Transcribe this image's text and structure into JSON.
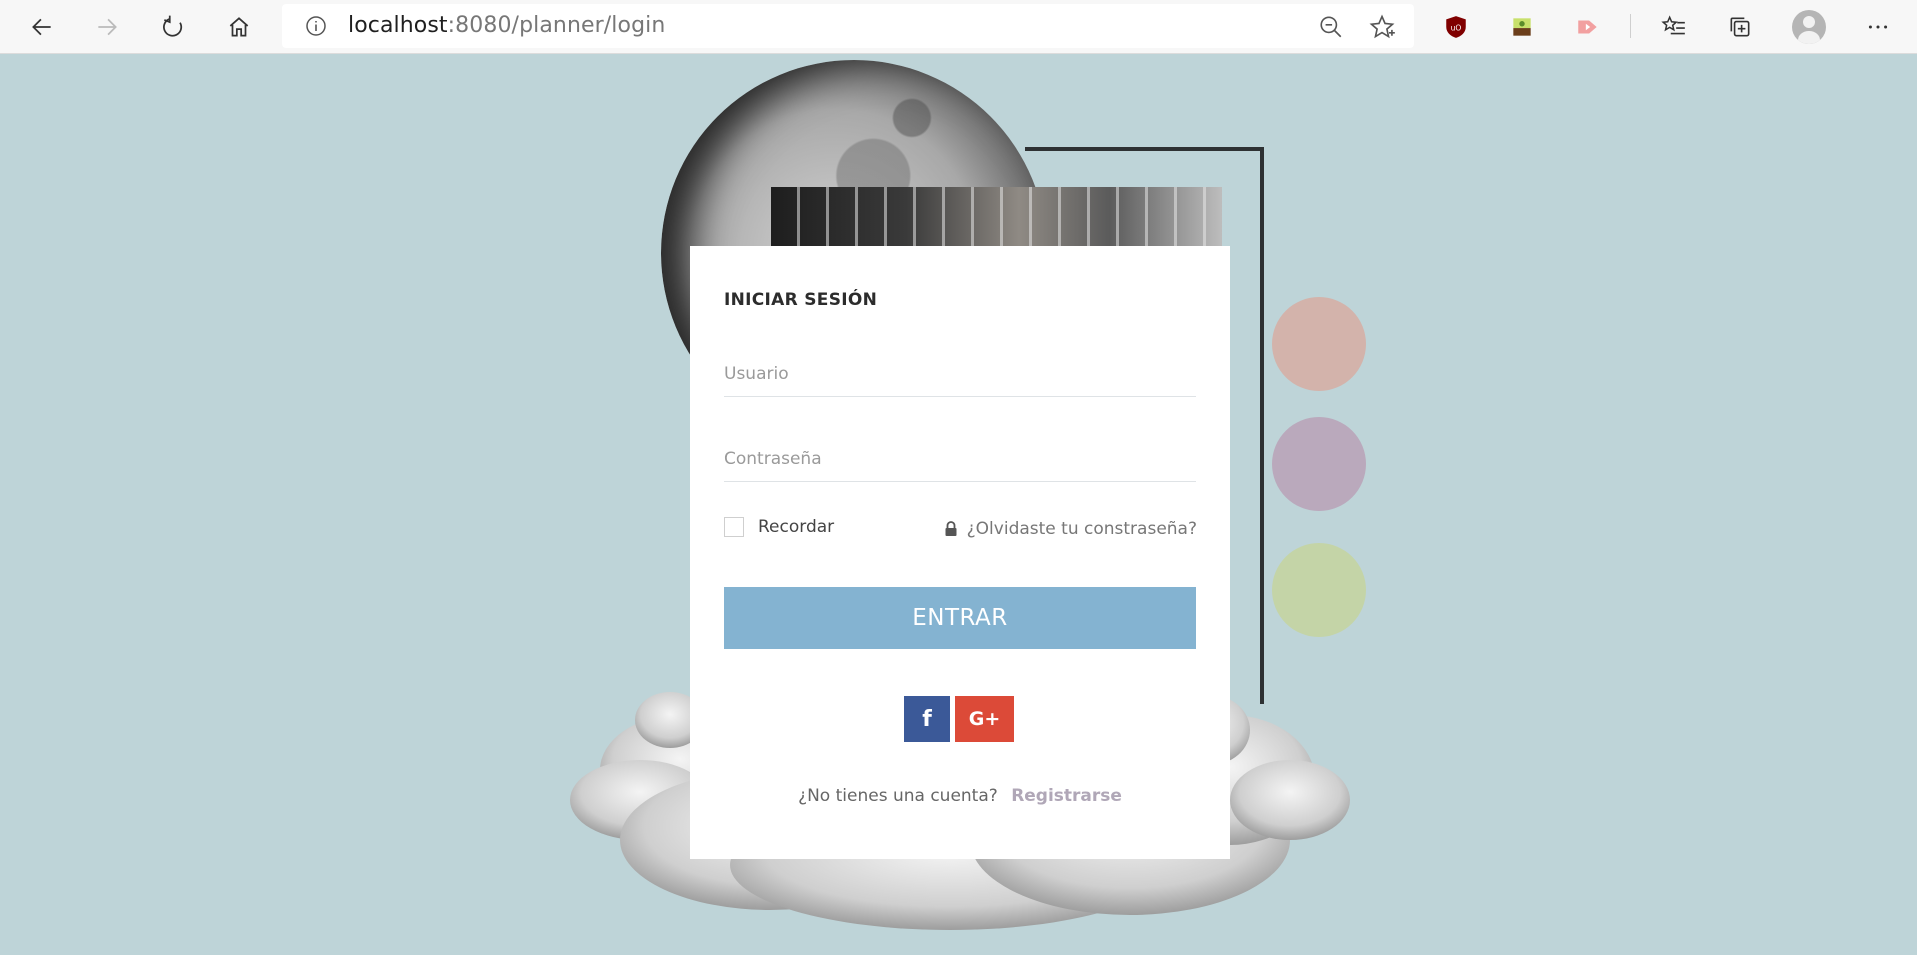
{
  "browser": {
    "url_host": "localhost",
    "url_rest": ":8080/planner/login",
    "icons": [
      "back-icon",
      "forward-icon",
      "refresh-icon",
      "home-icon",
      "info-icon",
      "zoom-icon",
      "favorite-star-icon",
      "ublock-icon",
      "extension-icon",
      "media-extension-icon",
      "favorites-list-icon",
      "collections-icon",
      "profile-avatar-icon",
      "more-icon"
    ]
  },
  "login": {
    "title": "INICIAR SESIÓN",
    "username_placeholder": "Usuario",
    "password_placeholder": "Contraseña",
    "remember_label": "Recordar",
    "forgot_label": "¿Olvidaste tu constraseña?",
    "submit_label": "ENTRAR",
    "facebook_label": "f",
    "google_label": "G+",
    "no_account_text": "¿No tienes una cuenta?",
    "register_label": "Registrarse"
  },
  "colors": {
    "page_background": "#bed4d8",
    "primary_button": "#84b3d1",
    "facebook": "#3b5998",
    "google_plus": "#dc4a38",
    "dot_rose": "#d3b3ab",
    "dot_mauve": "#baa9bc",
    "dot_lime": "#c4d4a7"
  }
}
